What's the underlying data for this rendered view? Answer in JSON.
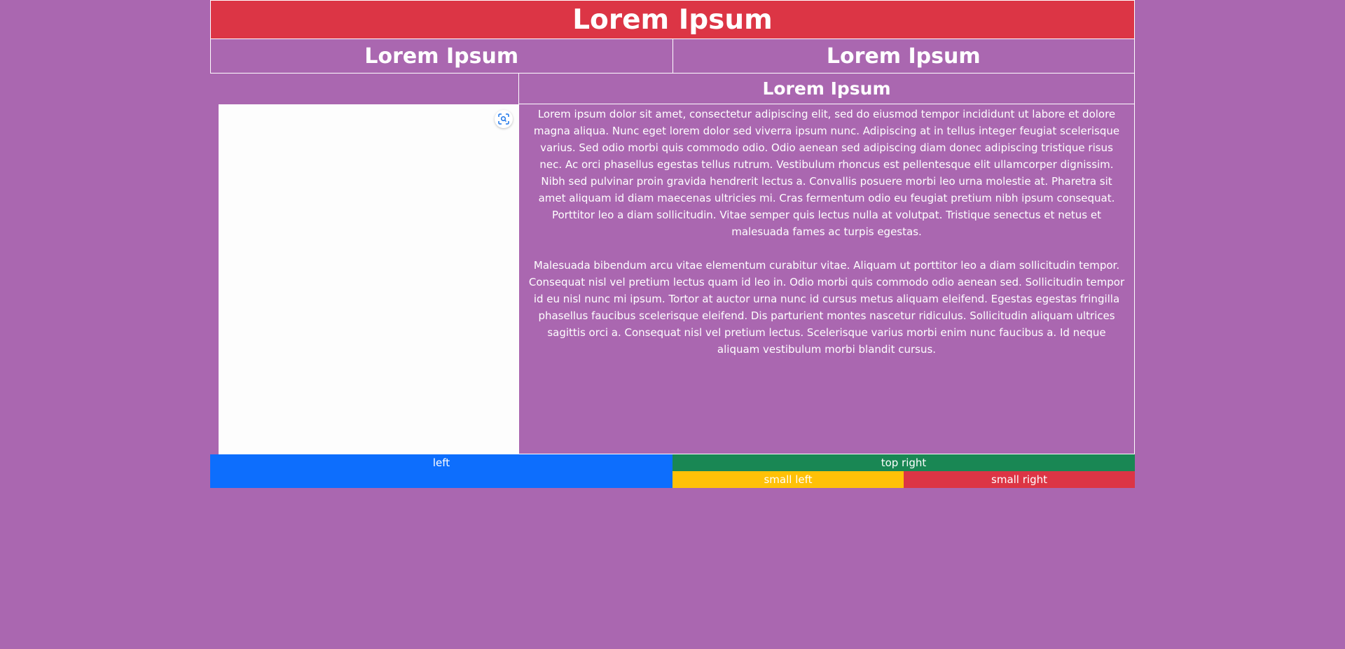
{
  "header": {
    "title": "Lorem Ipsum"
  },
  "subheaders": {
    "left": "Lorem Ipsum",
    "right": "Lorem Ipsum"
  },
  "content": {
    "title": "Lorem Ipsum",
    "paragraphs": [
      "Lorem ipsum dolor sit amet, consectetur adipiscing elit, sed do eiusmod tempor incididunt ut labore et dolore magna aliqua. Nunc eget lorem dolor sed viverra ipsum nunc. Adipiscing at in tellus integer feugiat scelerisque varius. Sed odio morbi quis commodo odio. Odio aenean sed adipiscing diam donec adipiscing tristique risus nec. Ac orci phasellus egestas tellus rutrum. Vestibulum rhoncus est pellentesque elit ullamcorper dignissim. Nibh sed pulvinar proin gravida hendrerit lectus a. Convallis posuere morbi leo urna molestie at. Pharetra sit amet aliquam id diam maecenas ultricies mi. Cras fermentum odio eu feugiat pretium nibh ipsum consequat. Porttitor leo a diam sollicitudin. Vitae semper quis lectus nulla at volutpat. Tristique senectus et netus et malesuada fames ac turpis egestas.",
      "Malesuada bibendum arcu vitae elementum curabitur vitae. Aliquam ut porttitor leo a diam sollicitudin tempor. Consequat nisl vel pretium lectus quam id leo in. Odio morbi quis commodo odio aenean sed. Sollicitudin tempor id eu nisl nunc mi ipsum. Tortor at auctor urna nunc id cursus metus aliquam eleifend. Egestas egestas fringilla phasellus faucibus scelerisque eleifend. Dis parturient montes nascetur ridiculus. Sollicitudin aliquam ultrices sagittis orci a. Consequat nisl vel pretium lectus. Scelerisque varius morbi enim nunc faucibus a. Id neque aliquam vestibulum morbi blandit cursus."
    ]
  },
  "image_panel": {
    "icon": "visual-search-icon"
  },
  "footer": {
    "left": "left",
    "top_right": "top right",
    "small_left": "small left",
    "small_right": "small right"
  },
  "colors": {
    "background": "#aa67b0",
    "header": "#dc3545",
    "left_block": "#0d6efd",
    "top_right_block": "#198754",
    "small_left_block": "#ffc107",
    "small_right_block": "#dc3545"
  }
}
